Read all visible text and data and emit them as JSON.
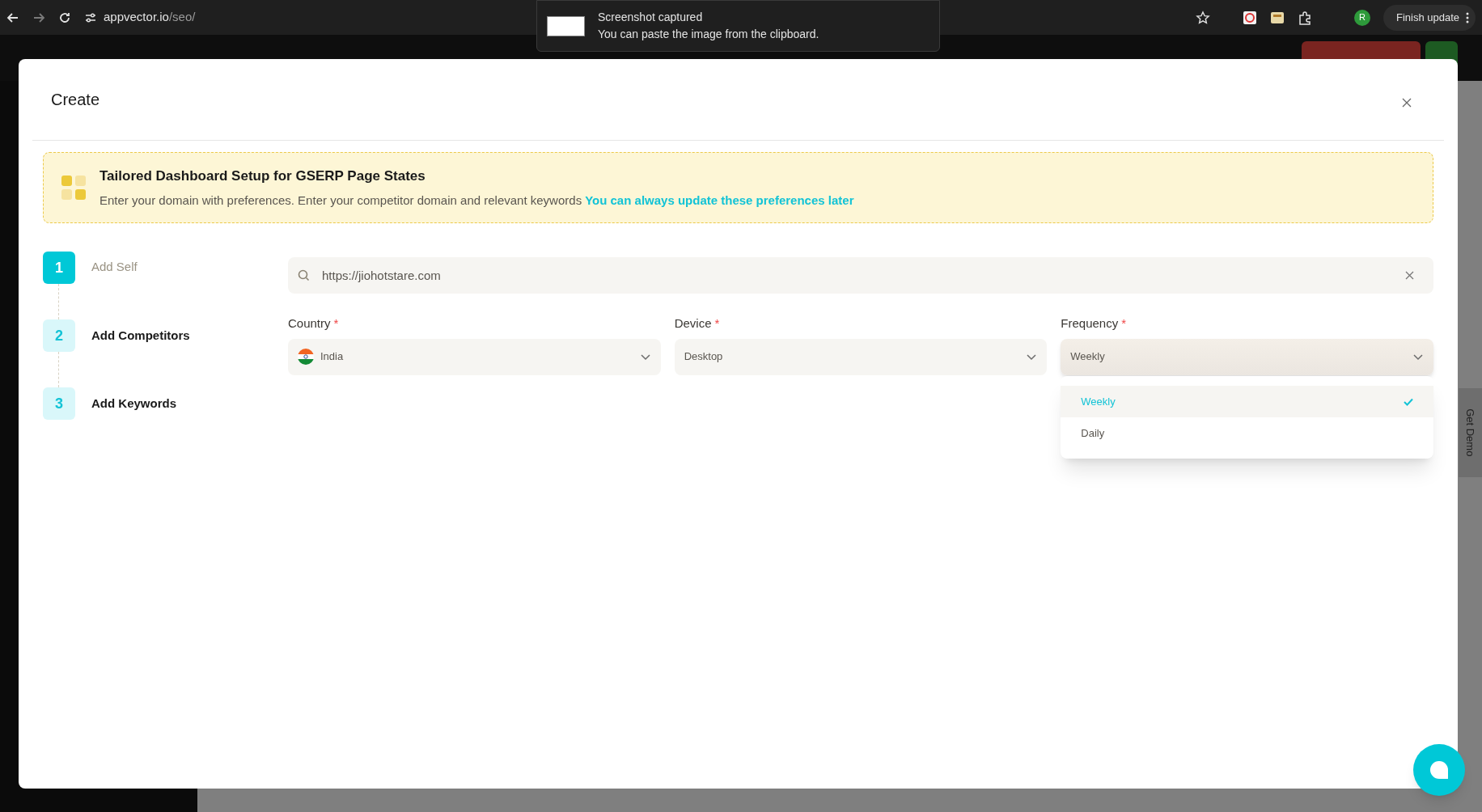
{
  "browser": {
    "url_host": "appvector.io",
    "url_path": "/seo/",
    "profile_initial": "R",
    "update_button": "Finish update"
  },
  "toast": {
    "title": "Screenshot captured",
    "message": "You can paste the image from the clipboard."
  },
  "background_page": {
    "side_tab": "Get Demo"
  },
  "modal": {
    "title": "Create",
    "banner": {
      "title": "Tailored Dashboard Setup for GSERP Page States",
      "text": "Enter your domain with preferences. Enter your competitor domain and relevant keywords",
      "link": "You can always update these preferences later"
    },
    "steps": [
      {
        "number": "1",
        "label": "Add Self",
        "selected": true
      },
      {
        "number": "2",
        "label": "Add Competitors",
        "selected": false
      },
      {
        "number": "3",
        "label": "Add Keywords",
        "selected": false
      }
    ],
    "search": {
      "value": "https://jiohotstare.com"
    },
    "fields": [
      {
        "kind": "flag",
        "label": "Country",
        "required_mark": "*",
        "value": "India",
        "open": false
      },
      {
        "kind": "plain",
        "label": "Device",
        "required_mark": "*",
        "value": "Desktop",
        "open": false
      },
      {
        "kind": "plain",
        "label": "Frequency",
        "required_mark": "*",
        "value": "Weekly",
        "open": true,
        "options": [
          {
            "label": "Weekly",
            "selected": true
          },
          {
            "label": "Daily",
            "selected": false
          }
        ]
      }
    ]
  }
}
